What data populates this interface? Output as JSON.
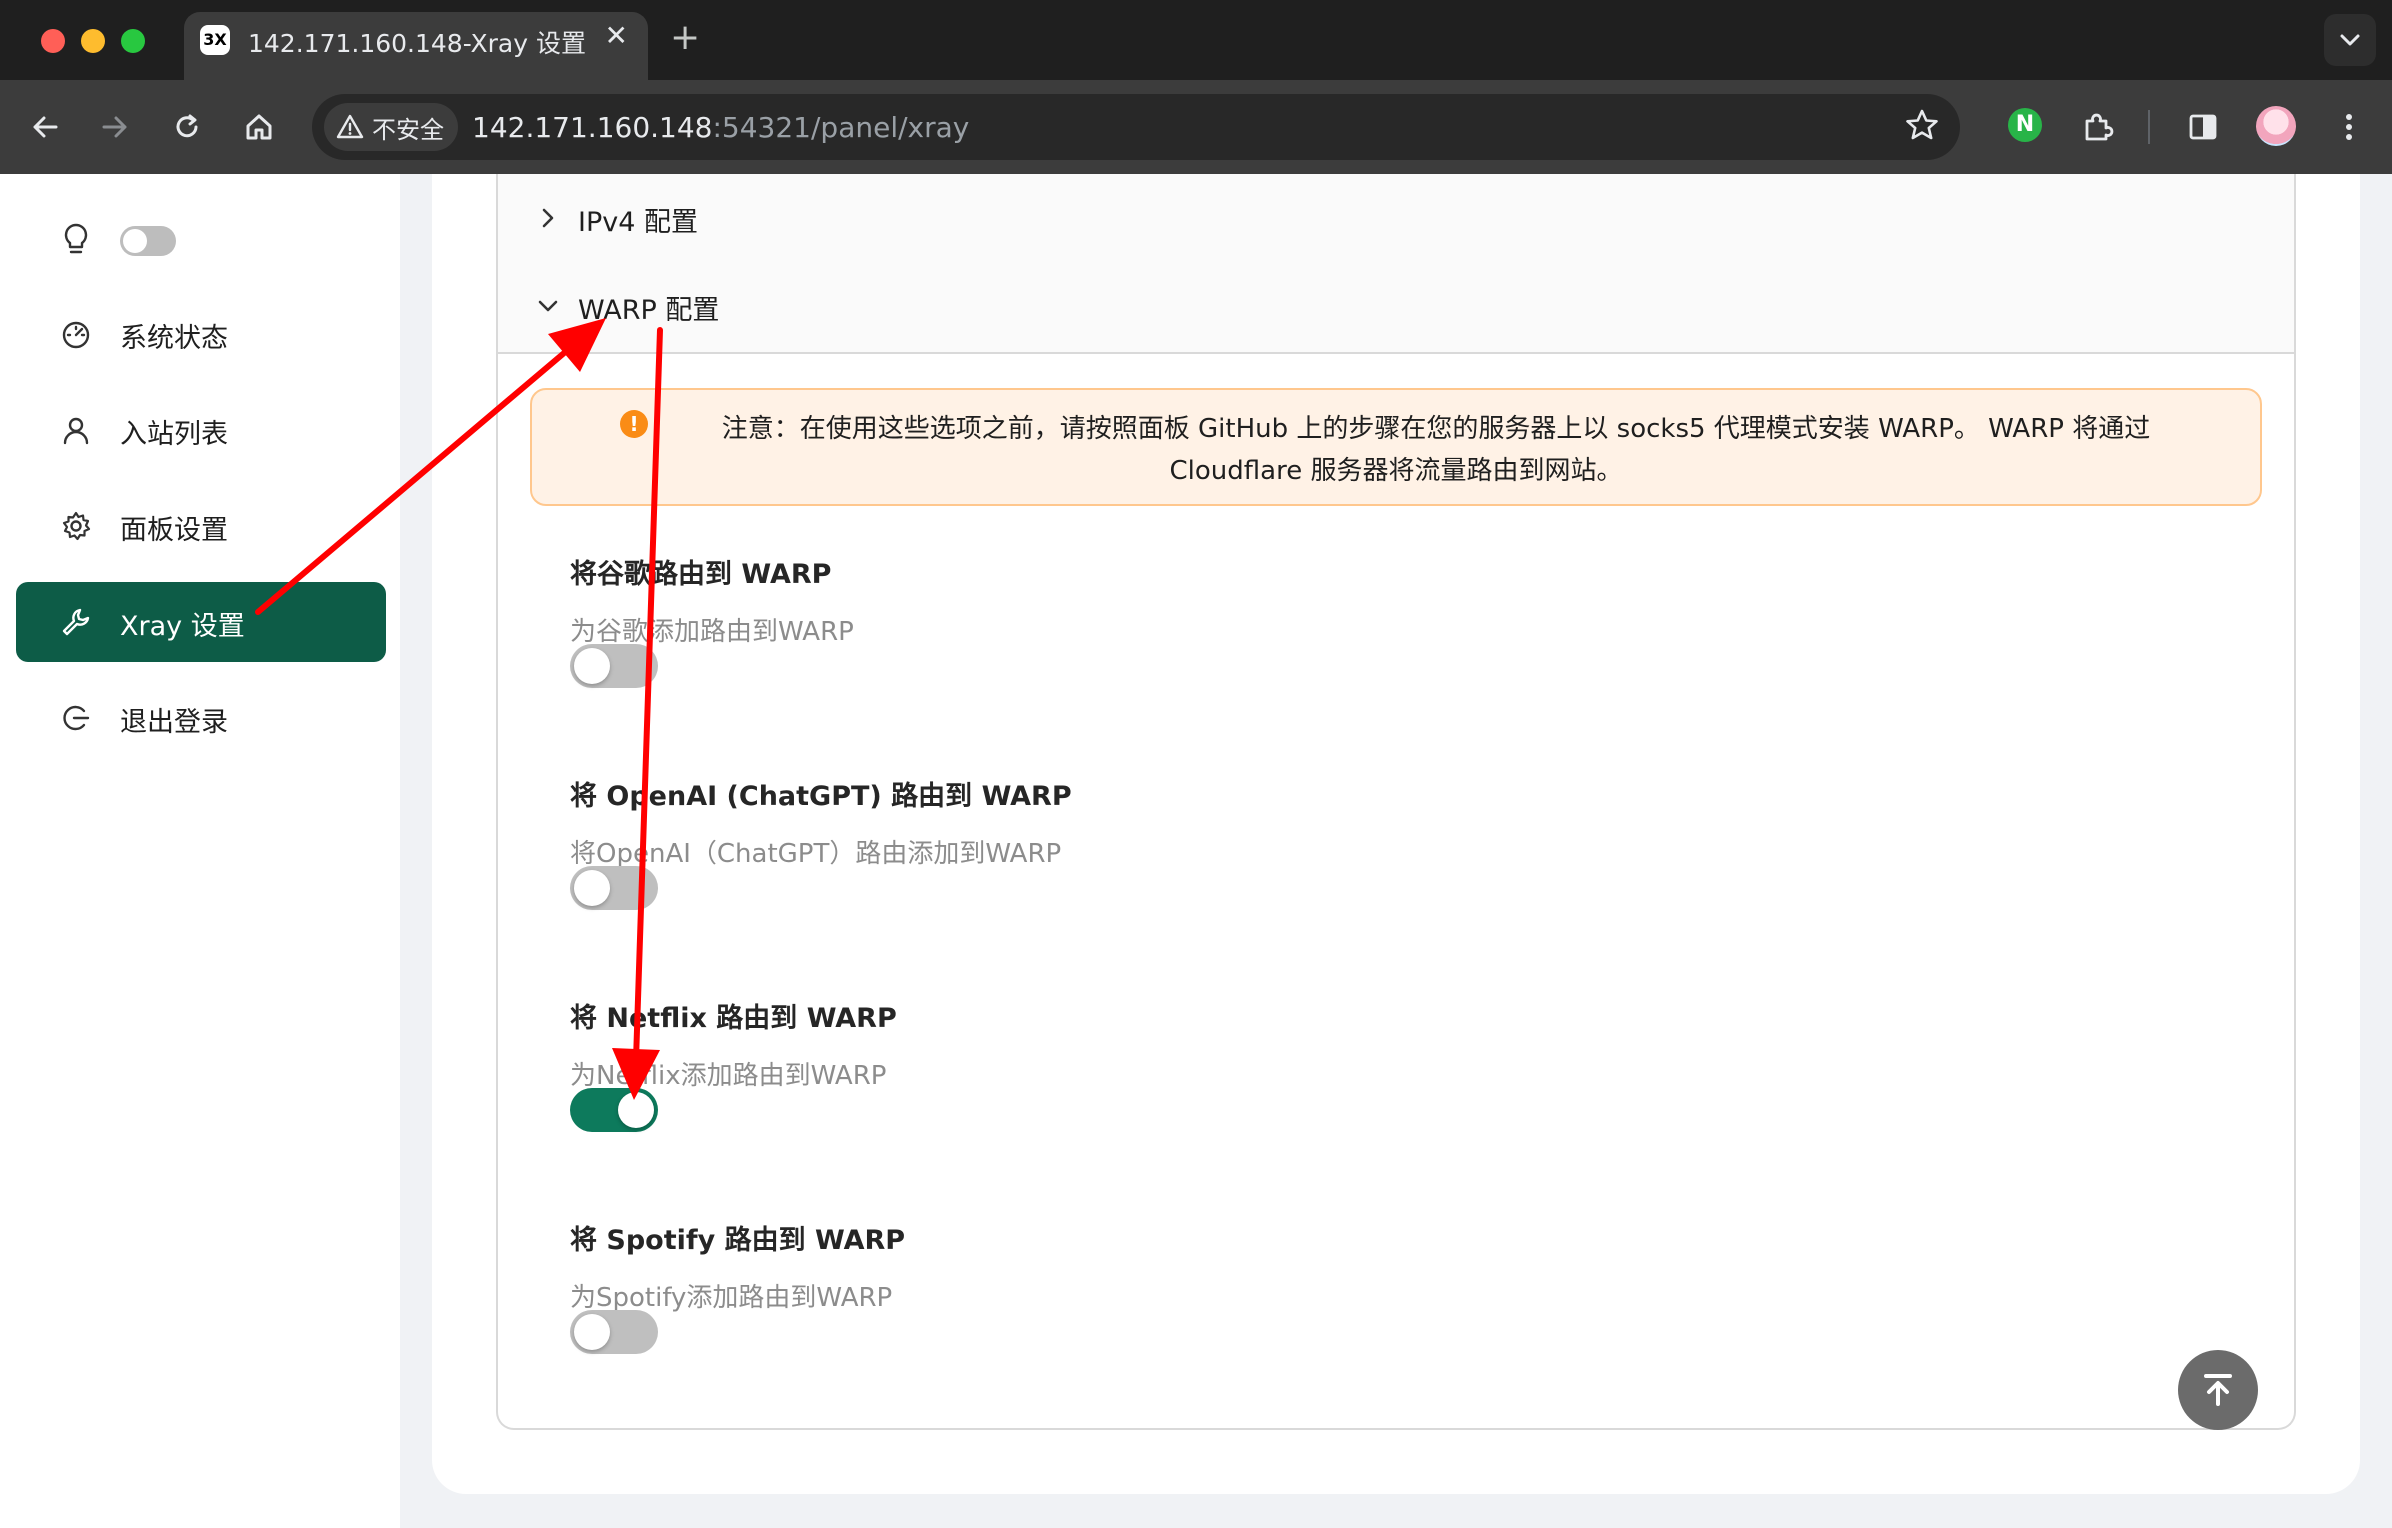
{
  "browser": {
    "tab_favicon_text": "3X",
    "tab_title": "142.171.160.148-Xray 设置",
    "tab_close": "✕",
    "new_tab": "+",
    "security_label": "不安全",
    "url_host": "142.171.160.148",
    "url_path": ":54321/panel/xray",
    "extension_letter": "N"
  },
  "sidebar": {
    "items": [
      {
        "label": "系统状态",
        "icon": "dashboard-icon"
      },
      {
        "label": "入站列表",
        "icon": "user-icon"
      },
      {
        "label": "面板设置",
        "icon": "gear-icon"
      },
      {
        "label": "Xray 设置",
        "icon": "wrench-icon",
        "active": true
      },
      {
        "label": "退出登录",
        "icon": "logout-icon"
      }
    ],
    "theme_toggle_on": false
  },
  "panel": {
    "ipv4_header": "IPv4 配置",
    "warp_header": "WARP 配置",
    "alert": {
      "line1": "注意：在使用这些选项之前，请按照面板 GitHub 上的步骤在您的服务器上以 socks5 代理模式安装 WARP。 WARP 将通过",
      "line2": "Cloudflare 服务器将流量路由到网站。"
    },
    "settings": [
      {
        "title": "将谷歌路由到 WARP",
        "desc": "为谷歌添加路由到WARP",
        "enabled": false
      },
      {
        "title": "将 OpenAI (ChatGPT) 路由到 WARP",
        "desc": "将OpenAI（ChatGPT）路由添加到WARP",
        "enabled": false
      },
      {
        "title": "将 Netflix 路由到 WARP",
        "desc": "为Netflix添加路由到WARP",
        "enabled": true
      },
      {
        "title": "将 Spotify 路由到 WARP",
        "desc": "为Spotify添加路由到WARP",
        "enabled": false
      }
    ]
  },
  "colors": {
    "accent": "#0d5c47",
    "switch_on": "#0d7a5c",
    "alert_bg": "#fff2e6",
    "annotation_arrow": "#ff0000"
  }
}
